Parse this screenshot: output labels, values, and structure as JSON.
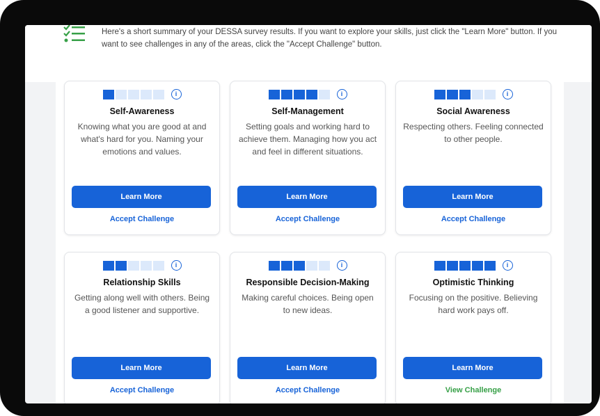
{
  "intro": {
    "icon": "checklist-icon",
    "text": "Here's a short summary of your DESSA survey results. If you want to explore your skills, just click the \"Learn More\" button. If you want to see challenges in any of the areas, click the \"Accept Challenge\" button."
  },
  "colors": {
    "primary": "#1763d8",
    "meter_empty": "#dce9fb",
    "view_challenge": "#37a047"
  },
  "cards": [
    {
      "title": "Self-Awareness",
      "level": 1,
      "max_level": 5,
      "description": "Knowing what you are good at and what's hard for you. Naming your emotions and values.",
      "learn_label": "Learn More",
      "challenge_label": "Accept Challenge",
      "info_icon": "info-icon"
    },
    {
      "title": "Self-Management",
      "level": 4,
      "max_level": 5,
      "description": "Setting goals and working hard to achieve them. Managing how you act and feel in different situations.",
      "learn_label": "Learn More",
      "challenge_label": "Accept Challenge",
      "info_icon": "info-icon"
    },
    {
      "title": "Social Awareness",
      "level": 3,
      "max_level": 5,
      "description": "Respecting others. Feeling connected to other people.",
      "learn_label": "Learn More",
      "challenge_label": "Accept Challenge",
      "info_icon": "info-icon"
    },
    {
      "title": "Relationship Skills",
      "level": 2,
      "max_level": 5,
      "description": "Getting along well with others. Being a good listener and supportive.",
      "learn_label": "Learn More",
      "challenge_label": "Accept Challenge",
      "info_icon": "info-icon"
    },
    {
      "title": "Responsible Decision-Making",
      "level": 3,
      "max_level": 5,
      "description": "Making careful choices. Being open to new ideas.",
      "learn_label": "Learn More",
      "challenge_label": "Accept Challenge",
      "info_icon": "info-icon"
    },
    {
      "title": "Optimistic Thinking",
      "level": 5,
      "max_level": 5,
      "description": "Focusing on the positive. Believing hard work pays off.",
      "learn_label": "Learn More",
      "challenge_label": "View Challenge",
      "info_icon": "info-icon"
    }
  ]
}
